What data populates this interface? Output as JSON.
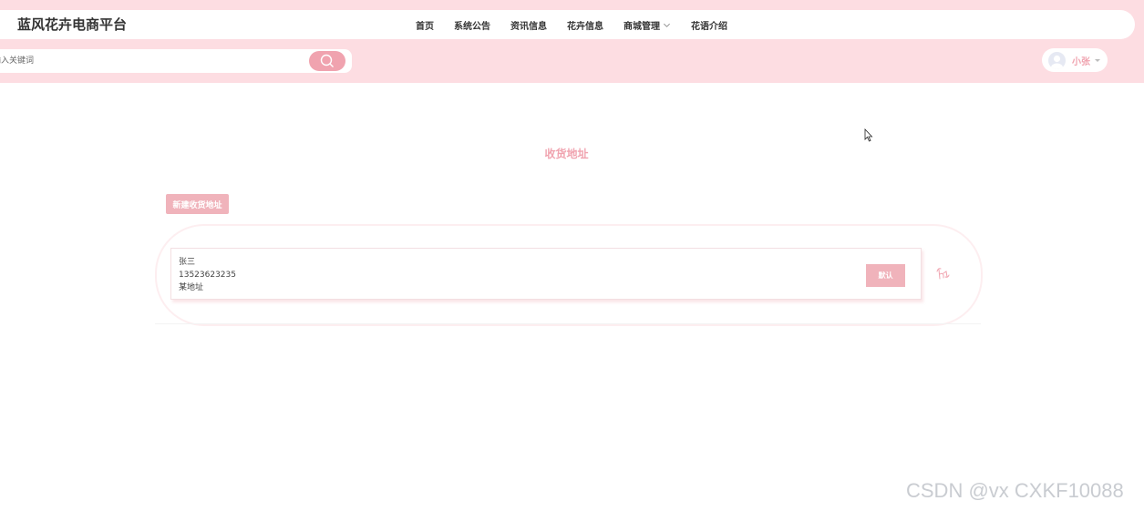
{
  "header": {
    "site_title": "蓝风花卉电商平台",
    "nav": [
      {
        "label": "首页"
      },
      {
        "label": "系统公告"
      },
      {
        "label": "资讯信息"
      },
      {
        "label": "花卉信息"
      },
      {
        "label": "商城管理",
        "has_dropdown": true
      },
      {
        "label": "花语介绍"
      }
    ],
    "search": {
      "placeholder": "输入关键词",
      "icon": "search-icon"
    },
    "user": {
      "name": "小张",
      "icon": "avatar-icon"
    }
  },
  "main": {
    "page_title": "收货地址",
    "new_address_label": "新建收货地址",
    "addresses": [
      {
        "name": "张三",
        "phone": "13523623235",
        "address": "某地址",
        "default_label": "默认",
        "edit_icon": "edit-icon"
      }
    ]
  },
  "watermark": "CSDN @vx  CXKF10088",
  "colors": {
    "header_bg": "#fddde2",
    "accent": "#f0a3af",
    "button": "#f0b3bb"
  }
}
